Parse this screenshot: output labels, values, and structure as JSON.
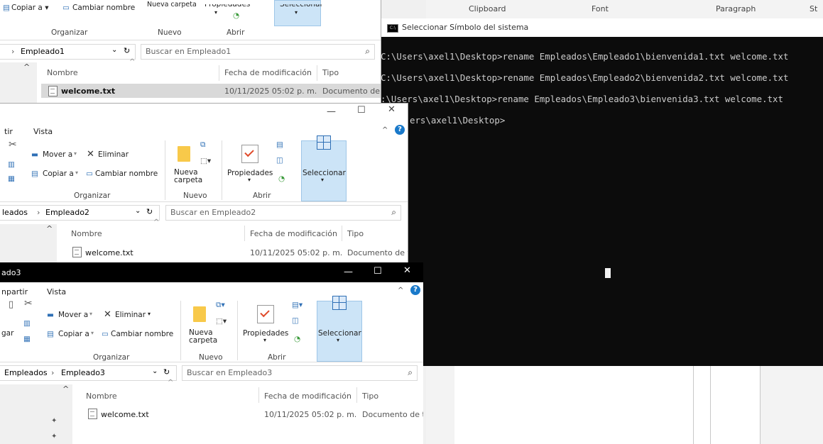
{
  "word": {
    "ribbon": [
      "Clipboard",
      "Font",
      "Paragraph",
      "St"
    ]
  },
  "cmd": {
    "title": "Seleccionar Símbolo del sistema",
    "lines": [
      "C:\\Users\\axel1\\Desktop>rename Empleados\\Empleado1\\bienvenida1.txt welcome.txt",
      "C:\\Users\\axel1\\Desktop>rename Empleados\\Empleado2\\bienvenida2.txt welcome.txt",
      ":\\Users\\axel1\\Desktop>rename Empleados\\Empleado3\\bienvenida3.txt welcome.txt",
      "ers\\axel1\\Desktop>"
    ]
  },
  "win1": {
    "ribbon": {
      "copy": "Copiar a ▾",
      "rename": "Cambiar nombre",
      "new_folder": "Nueva carpeta",
      "properties": "Propiedades",
      "select": "Seleccionar",
      "group_organize": "Organizar",
      "group_new": "Nuevo",
      "group_open": "Abrir"
    },
    "address": "Empleado1",
    "address_prefix": "›",
    "search_placeholder": "Buscar en Empleado1",
    "columns": {
      "name": "Nombre",
      "date": "Fecha de modificación",
      "type": "Tipo"
    },
    "file": {
      "name": "welcome.txt",
      "date": "10/11/2025 05:02 p. m.",
      "type": "Documento de te"
    }
  },
  "win2": {
    "tabs": [
      "tir",
      "Vista"
    ],
    "ribbon": {
      "move": "Mover a",
      "delete": "Eliminar",
      "copy": "Copiar a",
      "rename": "Cambiar nombre",
      "new_folder_1": "Nueva",
      "new_folder_2": "carpeta",
      "properties": "Propiedades",
      "select": "Seleccionar",
      "group_organize": "Organizar",
      "group_new": "Nuevo",
      "group_open": "Abrir"
    },
    "address_1": "leados",
    "address_2": "Empleado2",
    "search_placeholder": "Buscar en Empleado2",
    "columns": {
      "name": "Nombre",
      "date": "Fecha de modificación",
      "type": "Tipo"
    },
    "file": {
      "name": "welcome.txt",
      "date": "10/11/2025 05:02 p. m.",
      "type": "Documento de te"
    }
  },
  "win3": {
    "title": "ado3",
    "tabs": [
      "npartir",
      "Vista"
    ],
    "ribbon": {
      "move": "Mover a",
      "delete": "Eliminar",
      "copy": "Copiar a",
      "rename": "Cambiar nombre",
      "paste": "gar",
      "new_folder_1": "Nueva",
      "new_folder_2": "carpeta",
      "properties": "Propiedades",
      "select": "Seleccionar",
      "group_organize": "Organizar",
      "group_new": "Nuevo",
      "group_open": "Abrir"
    },
    "address_1": "Empleados",
    "address_2": "Empleado3",
    "search_placeholder": "Buscar en Empleado3",
    "columns": {
      "name": "Nombre",
      "date": "Fecha de modificación",
      "type": "Tipo"
    },
    "file": {
      "name": "welcome.txt",
      "date": "10/11/2025 05:02 p. m.",
      "type": "Documento de te"
    }
  },
  "colors": {
    "cmd_bg": "#0c0c0c",
    "cmd_text": "#cccccc",
    "selection": "#cce4f7",
    "win3_title_bg": "#000000"
  }
}
